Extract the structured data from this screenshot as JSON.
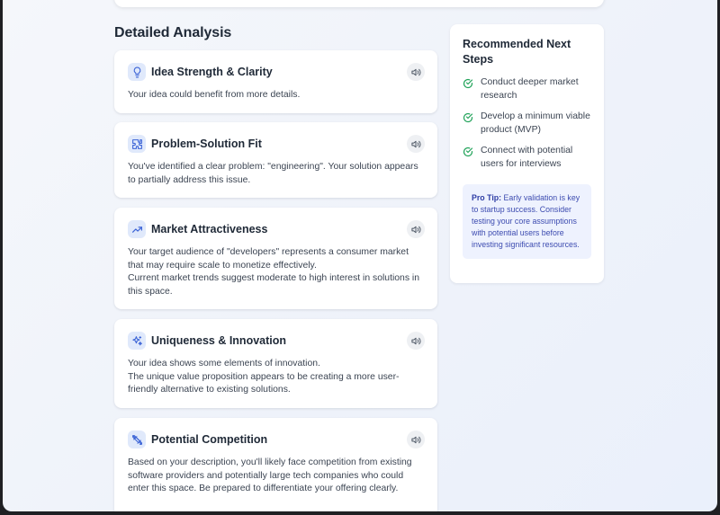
{
  "section_title": "Detailed Analysis",
  "analysis_cards": [
    {
      "icon": "lightbulb-icon",
      "title": "Idea Strength & Clarity",
      "lines": [
        "Your idea could benefit from more details."
      ]
    },
    {
      "icon": "puzzle-icon",
      "title": "Problem-Solution Fit",
      "lines": [
        "You've identified a clear problem: \"engineering\". Your solution appears to partially address this issue."
      ]
    },
    {
      "icon": "trending-up-icon",
      "title": "Market Attractiveness",
      "lines": [
        "Your target audience of \"developers\" represents a consumer market that may require scale to monetize effectively.",
        "Current market trends suggest moderate to high interest in solutions in this space."
      ]
    },
    {
      "icon": "sparkles-icon",
      "title": "Uniqueness & Innovation",
      "lines": [
        "Your idea shows some elements of innovation.",
        "The unique value proposition appears to be creating a more user-friendly alternative to existing solutions."
      ]
    },
    {
      "icon": "swords-icon",
      "title": "Potential Competition",
      "lines": [
        "Based on your description, you'll likely face competition from existing software providers and potentially large tech companies who could enter this space. Be prepared to differentiate your offering clearly."
      ]
    }
  ],
  "next_steps": {
    "title": "Recommended Next Steps",
    "items": [
      "Conduct deeper market research",
      "Develop a minimum viable product (MVP)",
      "Connect with potential users for interviews"
    ],
    "tip_label": "Pro Tip:",
    "tip_text": " Early validation is key to startup success. Consider testing your core assumptions with potential users before investing significant resources."
  },
  "colors": {
    "accent": "#3b63d6",
    "check": "#22a35a",
    "icon_bg": "#e0e9fb",
    "tip_bg": "#eef2fe"
  }
}
